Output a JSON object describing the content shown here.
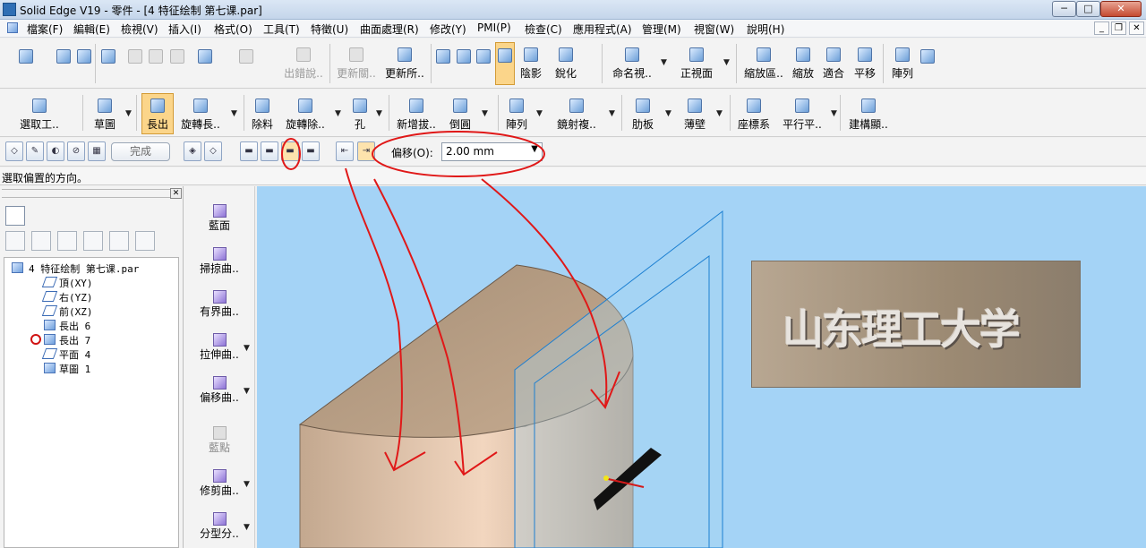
{
  "window": {
    "title": "Solid Edge V19 - 零件 - [4 特征绘制 第七课.par]",
    "min": "─",
    "max": "□",
    "close": "✕",
    "mdi_min": "_",
    "mdi_restore": "❐",
    "mdi_close": "✕"
  },
  "menu": [
    "檔案(F)",
    "編輯(E)",
    "檢視(V)",
    "插入(I)",
    "格式(O)",
    "工具(T)",
    "特徵(U)",
    "曲面處理(R)",
    "修改(Y)",
    "PMI(P)",
    "檢查(C)",
    "應用程式(A)",
    "管理(M)",
    "視窗(W)",
    "說明(H)"
  ],
  "toolbar1": {
    "labels": [
      "出錯說..",
      "更新關..",
      "更新所..",
      "陰影",
      "銳化",
      "命名視..",
      "正視面",
      "縮放區..",
      "縮放",
      "適合",
      "平移",
      "陣列"
    ]
  },
  "toolbar2": {
    "labels": [
      "選取工..",
      "草圖",
      "長出",
      "旋轉長..",
      "除料",
      "旋轉除..",
      "孔",
      "新增拔..",
      "倒圓",
      "陣列",
      "鏡射複..",
      "肋板",
      "薄壁",
      "座標系",
      "平行平..",
      "建構顯.."
    ]
  },
  "option_bar": {
    "finish": "完成",
    "offset_label": "偏移(O):",
    "offset_value": "2.00 mm"
  },
  "prompt": "選取偏置的方向。",
  "tree": {
    "root": "4 特征绘制 第七课.par",
    "items": [
      "頂(XY)",
      "右(YZ)",
      "前(XZ)",
      "長出 6",
      "長出 7",
      "平面 4",
      "草圖 1"
    ]
  },
  "surface_ribbon": [
    "藍面",
    "掃掠曲..",
    "有界曲..",
    "拉伸曲..",
    "偏移曲..",
    "藍點",
    "修剪曲..",
    "分型分.."
  ],
  "viewport": {
    "model_text": "山东理工大学",
    "background": "#a4d3f6",
    "annotation_color": "#e01818"
  }
}
